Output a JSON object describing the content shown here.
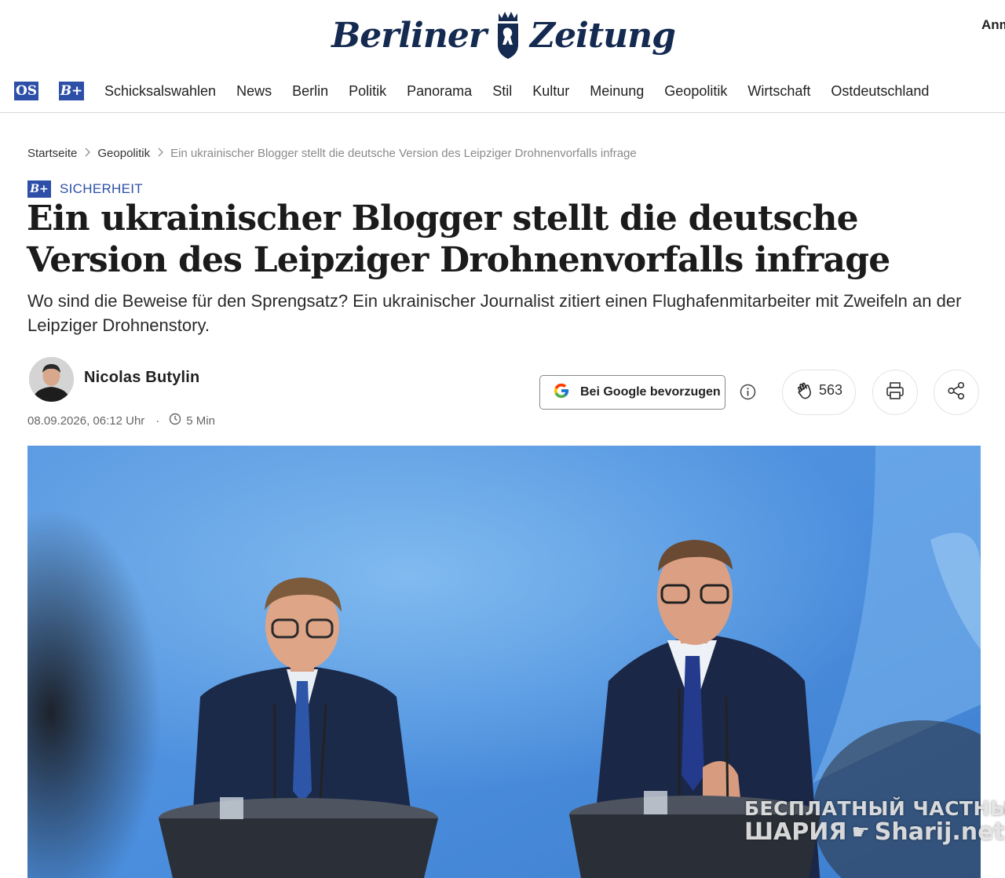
{
  "header": {
    "logo_left": "Berliner",
    "logo_right": "Zeitung",
    "right_link": "Anm"
  },
  "nav": {
    "badge_os": "OS",
    "badge_bplus": "B+",
    "items": [
      "Schicksalswahlen",
      "News",
      "Berlin",
      "Politik",
      "Panorama",
      "Stil",
      "Kultur",
      "Meinung",
      "Geopolitik",
      "Wirtschaft",
      "Ostdeutschland"
    ]
  },
  "breadcrumb": {
    "home": "Startseite",
    "section": "Geopolitik",
    "current": "Ein ukrainischer Blogger stellt die deutsche Version des Leipziger Drohnenvorfalls infrage"
  },
  "article": {
    "kicker_badge": "B+",
    "kicker": "SICHERHEIT",
    "headline": "Ein ukrainischer Blogger stellt die deutsche Version des Leipziger Drohnenvorfalls infrage",
    "subline": "Wo sind die Beweise für den Sprengsatz? Ein ukrainischer Journalist zitiert einen Flughafenmitarbeiter mit Zweifeln an der Leipziger Drohnenstory.",
    "author": "Nicolas Butylin",
    "date": "08.09.2026, 06:12 Uhr",
    "read_time": "5 Min"
  },
  "actions": {
    "google_label": "Bei Google bevorzugen",
    "clap_count": "563"
  },
  "watermark": {
    "line1": "БЕСПЛАТНЫЙ ЧАСТНЫЙ",
    "line2_left": "ШАРИЯ",
    "line2_right": "Sharij.net"
  },
  "colors": {
    "brand_blue": "#2d4fa8",
    "logo_navy": "#152a50",
    "hero_bg": "#4f9ae0"
  },
  "icons": [
    "crest-icon",
    "chevron-right-icon",
    "clock-icon",
    "google-g-icon",
    "info-icon",
    "clap-icon",
    "print-icon",
    "share-icon"
  ]
}
